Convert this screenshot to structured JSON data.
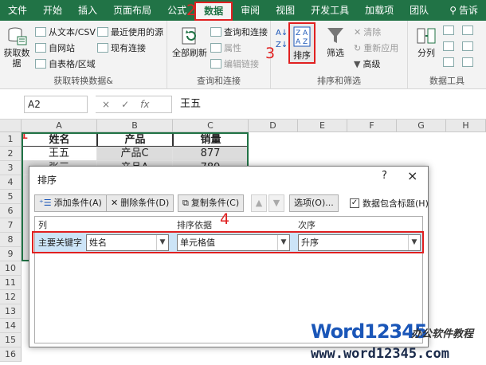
{
  "ribbon_tabs": [
    {
      "label": "文件"
    },
    {
      "label": "开始"
    },
    {
      "label": "插入"
    },
    {
      "label": "页面布局"
    },
    {
      "label": "公式"
    },
    {
      "label": "数据",
      "active": true
    },
    {
      "label": "审阅"
    },
    {
      "label": "视图"
    },
    {
      "label": "开发工具"
    },
    {
      "label": "加载项"
    },
    {
      "label": "团队"
    }
  ],
  "share_label": "告诉",
  "groups": {
    "get": {
      "label": "获取转换数据&",
      "big_btn": "获取数\n据",
      "items": [
        "从文本/CSV",
        "自网站",
        "自表格/区域",
        "最近使用的源",
        "现有连接"
      ]
    },
    "query": {
      "label": "查询和连接",
      "big_btn": "全部刷新",
      "items": [
        "查询和连接",
        "属性",
        "编辑链接"
      ]
    },
    "sortfilter": {
      "label": "排序和筛选",
      "sort": "排序",
      "filter": "筛选",
      "items": [
        "清除",
        "重新应用",
        "高级"
      ]
    },
    "datatools": {
      "label": "数据工具",
      "split": "分列"
    }
  },
  "markers": {
    "m1": "1",
    "m2": "2",
    "m3": "3",
    "m4": "4"
  },
  "formula_bar": {
    "name_box": "A2",
    "cancel": "×",
    "enter": "✓",
    "fx": "fx",
    "value": "王五"
  },
  "columns": [
    "A",
    "B",
    "C",
    "D",
    "E",
    "F",
    "G",
    "H"
  ],
  "rows": [
    "1",
    "2",
    "3",
    "4",
    "5",
    "6",
    "7",
    "8",
    "9",
    "10",
    "11",
    "12",
    "13",
    "14",
    "15",
    "16"
  ],
  "table": {
    "headers": [
      "姓名",
      "产品",
      "销量"
    ],
    "rows": [
      [
        "王五",
        "产品C",
        "877"
      ],
      [
        "张三",
        "产品A",
        "789"
      ]
    ]
  },
  "dialog": {
    "title": "排序",
    "help": "?",
    "close": "×",
    "add": "添加条件(A)",
    "delete": "删除条件(D)",
    "copy": "复制条件(C)",
    "up": "▲",
    "down": "▼",
    "options": "选项(O)...",
    "has_header": "数据包含标题(H)",
    "has_header_checked": "✓",
    "col_header": "列",
    "basis_header": "排序依据",
    "order_header": "次序",
    "row_label": "主要关键字",
    "key_value": "姓名",
    "basis_value": "单元格值",
    "order_value": "升序"
  },
  "watermark": {
    "brand": "Word12345",
    "sub": "办公软件教程",
    "url": "www.word12345.com"
  },
  "colors": {
    "excel_green": "#217346",
    "highlight_red": "#e02020",
    "selection_blue": "#cce4f7"
  }
}
